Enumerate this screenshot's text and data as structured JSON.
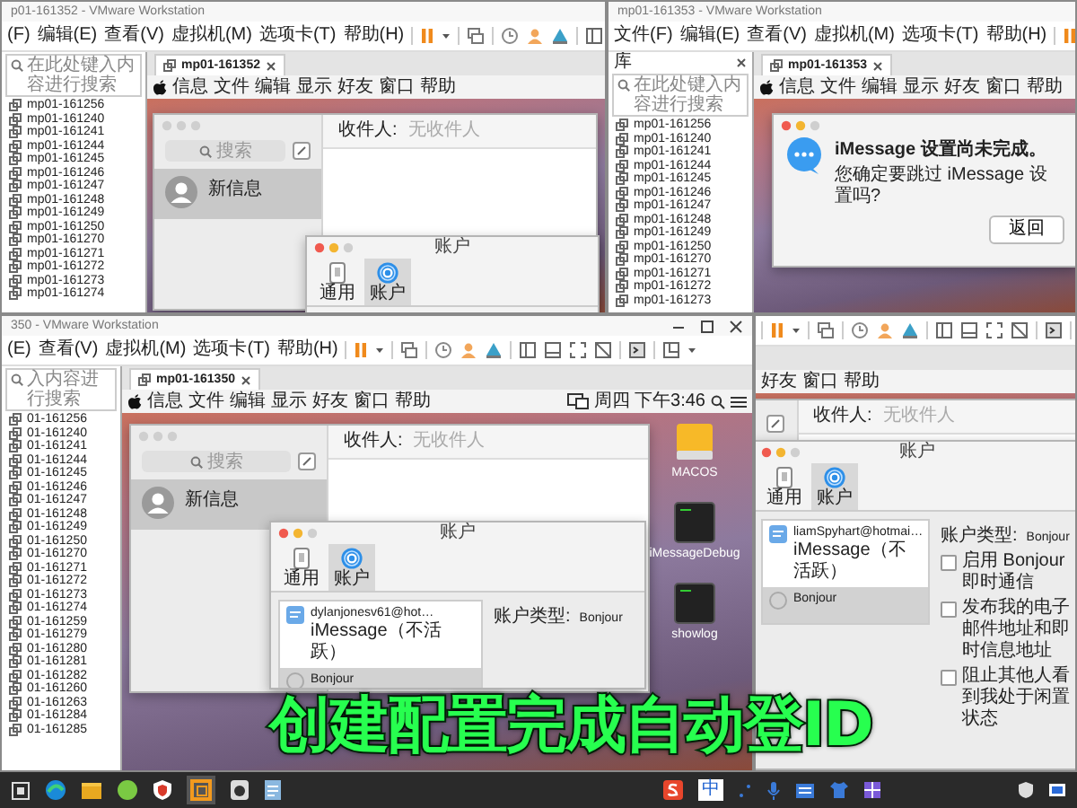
{
  "windows": [
    {
      "title": "p01-161352 - VMware Workstation",
      "window_controls": false,
      "menu": [
        "(F)",
        "编辑(E)",
        "查看(V)",
        "虚拟机(M)",
        "选项卡(T)",
        "帮助(H)"
      ],
      "library": {
        "placeholder": "在此处键入内容进行搜索",
        "items": [
          "mp01-161256",
          "mp01-161240",
          "mp01-161241",
          "mp01-161244",
          "mp01-161245",
          "mp01-161246",
          "mp01-161247",
          "mp01-161248",
          "mp01-161249",
          "mp01-161250",
          "mp01-161270",
          "mp01-161271",
          "mp01-161272",
          "mp01-161273",
          "mp01-161274"
        ]
      },
      "tab": "mp01-161352",
      "mac_menu": [
        "信息",
        "文件",
        "编辑",
        "显示",
        "好友",
        "窗口",
        "帮助"
      ],
      "messages": {
        "search_placeholder": "搜索",
        "contact": "新信息",
        "to_label": "收件人:",
        "to_placeholder": "无收件人"
      },
      "accounts": {
        "title": "账户",
        "tabs": [
          {
            "label": "通用",
            "kind": "general",
            "selected": false
          },
          {
            "label": "账户",
            "kind": "accounts",
            "selected": true
          }
        ]
      }
    },
    {
      "title": "mp01-161353 - VMware Workstation",
      "window_controls": false,
      "menu": [
        "文件(F)",
        "编辑(E)",
        "查看(V)",
        "虚拟机(M)",
        "选项卡(T)",
        "帮助(H)"
      ],
      "library": {
        "header": "库",
        "placeholder": "在此处键入内容进行搜索",
        "items": [
          "mp01-161256",
          "mp01-161240",
          "mp01-161241",
          "mp01-161244",
          "mp01-161245",
          "mp01-161246",
          "mp01-161247",
          "mp01-161248",
          "mp01-161249",
          "mp01-161250",
          "mp01-161270",
          "mp01-161271",
          "mp01-161272",
          "mp01-161273"
        ]
      },
      "tab": "mp01-161353",
      "mac_menu": [
        "信息",
        "文件",
        "编辑",
        "显示",
        "好友",
        "窗口",
        "帮助"
      ],
      "dialog": {
        "title": "iMessage 设置尚未完成。",
        "message": "您确定要跳过 iMessage 设置吗?",
        "button": "返回"
      }
    },
    {
      "title": "350 - VMware Workstation",
      "window_controls": true,
      "menu": [
        "(E)",
        "查看(V)",
        "虚拟机(M)",
        "选项卡(T)",
        "帮助(H)"
      ],
      "library": {
        "placeholder": "入内容进行搜索",
        "items": [
          "01-161256",
          "01-161240",
          "01-161241",
          "01-161244",
          "01-161245",
          "01-161246",
          "01-161247",
          "01-161248",
          "01-161249",
          "01-161250",
          "01-161270",
          "01-161271",
          "01-161272",
          "01-161273",
          "01-161274",
          "01-161259",
          "01-161279",
          "01-161280",
          "01-161281",
          "01-161282",
          "01-161260",
          "01-161263",
          "01-161284",
          "01-161285"
        ]
      },
      "tab": "mp01-161350",
      "mac_menu": [
        "信息",
        "文件",
        "编辑",
        "显示",
        "好友",
        "窗口",
        "帮助"
      ],
      "clock": "周四 下午3:46",
      "desktop_icons": [
        {
          "label": "MACOS",
          "kind": "drive"
        },
        {
          "label": "iMessageDebug",
          "kind": "terminal"
        },
        {
          "label": "showlog",
          "kind": "terminal"
        }
      ],
      "messages": {
        "search_placeholder": "搜索",
        "contact": "新信息",
        "to_label": "收件人:",
        "to_placeholder": "无收件人"
      },
      "accounts": {
        "title": "账户",
        "tabs": [
          {
            "label": "通用",
            "kind": "general",
            "selected": false
          },
          {
            "label": "账户",
            "kind": "accounts",
            "selected": true
          }
        ],
        "list": [
          {
            "name": "dylanjonesv61@hot…",
            "sub": "iMessage（不活跃）",
            "selected": false
          },
          {
            "name": "Bonjour",
            "selected": true
          }
        ],
        "type_label": "账户类型:",
        "type_value": "Bonjour"
      }
    },
    {
      "mac_menu": [
        "好友",
        "窗口",
        "帮助"
      ],
      "messages": {
        "to_label": "收件人:",
        "to_placeholder": "无收件人"
      },
      "accounts": {
        "title": "账户",
        "tabs": [
          {
            "label": "通用",
            "kind": "general",
            "selected": false
          },
          {
            "label": "账户",
            "kind": "accounts",
            "selected": true
          }
        ],
        "list": [
          {
            "name": "liamSpyhart@hotmai…",
            "sub": "iMessage（不活跃）",
            "selected": false
          },
          {
            "name": "Bonjour",
            "selected": true
          }
        ],
        "type_label": "账户类型:",
        "type_value": "Bonjour",
        "options": [
          {
            "label": "启用 Bonjour 即时通信",
            "checked": false
          },
          {
            "label": "发布我的电子邮件地址和即时信息地址",
            "checked": false
          },
          {
            "label": "阻止其他人看到我处于闲置状态",
            "checked": false
          }
        ]
      }
    }
  ],
  "taskbar": {
    "ime": "中"
  },
  "caption": "创建配置完成自动登ID"
}
